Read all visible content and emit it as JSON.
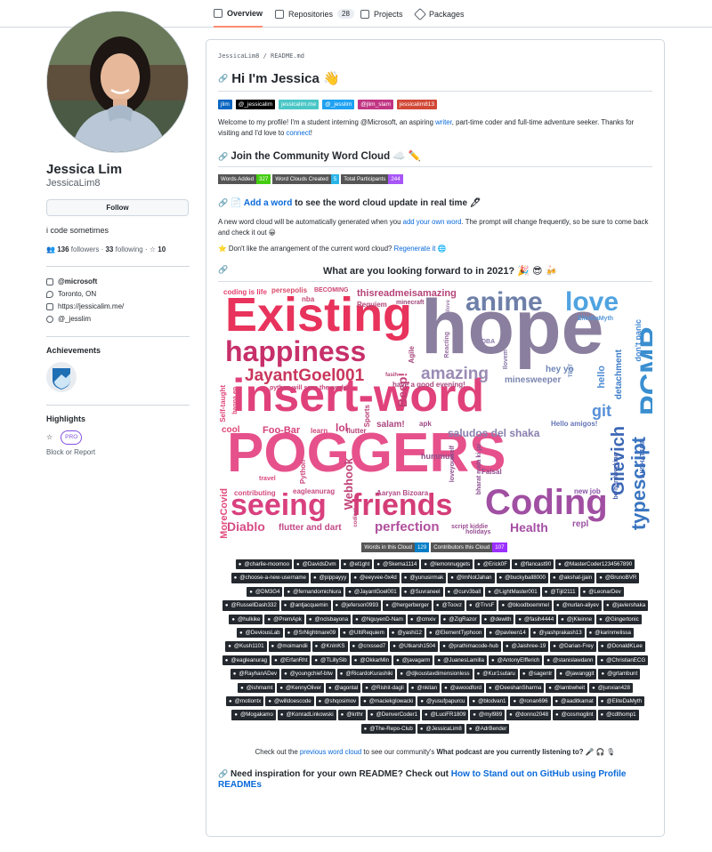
{
  "tabs": [
    {
      "label": "Overview"
    },
    {
      "label": "Repositories",
      "count": "28"
    },
    {
      "label": "Projects"
    },
    {
      "label": "Packages"
    }
  ],
  "profile": {
    "name": "Jessica Lim",
    "login": "JessicaLim8",
    "follow": "Follow",
    "bio": "i code sometimes",
    "followers_num": "136",
    "followers_label": "followers",
    "following_num": "33",
    "following_label": "following",
    "stars": "10",
    "org": "@microsoft",
    "location": "Toronto, ON",
    "website": "https://jessicalim.me/",
    "twitter": "@_jesslim"
  },
  "achievements": {
    "title": "Achievements"
  },
  "highlights": {
    "title": "Highlights",
    "pro": "PRO",
    "block": "Block or Report"
  },
  "readme": {
    "path": "JessicaLim8 / README.md",
    "title": "Hi I'm Jessica 👋",
    "socials": [
      {
        "label": "jlim",
        "color": "#0a66c2"
      },
      {
        "label": "@_jessicalim",
        "color": "#000000"
      },
      {
        "label": "jessicalim.me",
        "color": "#4ac6c6"
      },
      {
        "label": "@_jesslim",
        "color": "#1da1f2"
      },
      {
        "label": "@jlim_slam",
        "color": "#c13584"
      },
      {
        "label": "jessicalim813",
        "color": "#d14836"
      }
    ],
    "intro_a": "Welcome to my profile! I'm a student interning @Microsoft, an aspiring ",
    "intro_writer": "writer",
    "intro_b": ", part-time coder and full-time adventure seeker. Thanks for visiting and I'd love to ",
    "intro_connect": "connect",
    "intro_c": "!",
    "community_title": "Join the Community Word Cloud ☁️ ✏️",
    "stats": [
      {
        "l": "Words Added",
        "r": "327",
        "c": "#4c1"
      },
      {
        "l": "Word Clouds Created",
        "r": "5",
        "c": "#29b5e8"
      },
      {
        "l": "Total Participants",
        "r": "244",
        "c": "#a855f7"
      }
    ],
    "add_prefix": "📄 ",
    "add_link": "Add a word",
    "add_suffix": " to see the word cloud update in real time 🖊",
    "gen_a": "A new word cloud will be automatically generated when you ",
    "gen_link": "add your own word",
    "gen_b": ". The prompt will change frequently, so be sure to come back and check it out 😀",
    "regen_a": "⭐ Don't like the arrangement of the current word cloud? ",
    "regen_link": "Regenerate it",
    "regen_b": " 🌐",
    "cloud_title": "What are you looking forward to in 2021? 🎉 😎 🍻",
    "cloud_stats": [
      {
        "l": "Words in this Cloud",
        "r": "129",
        "c": "#007ec6"
      },
      {
        "l": "Contributors this Cloud",
        "r": "107",
        "c": "#9b30ff"
      }
    ],
    "contributors": [
      "@charlie-moomoo",
      "@DavidsDvm",
      "@el1ght",
      "@Skema1114",
      "@lemonnuggets",
      "@Erick0F",
      "@flancast90",
      "@MasterCoder1234567890",
      "@choose-a-new-username",
      "@pippayyy",
      "@eeyvee-0x4d",
      "@yunusirmak",
      "@ImNotJahan",
      "@buckyball8000",
      "@akshat-jjain",
      "@BrunoBVR",
      "@DM3G4",
      "@fernandomichiura",
      "@JayantGoel001",
      "@Suvraneel",
      "@curv3ball",
      "@LightMaster001",
      "@Tijil2111",
      "@LeonarDev",
      "@RussellDash332",
      "@antjacquemin",
      "@jeferson0993",
      "@hergerberger",
      "@Toovz",
      "@TrvsF",
      "@bloodboemmel",
      "@nurlan-aliyev",
      "@javiershaka",
      "@hulkike",
      "@PremApk",
      "@nclsbayona",
      "@NguyenD-Nam",
      "@cmxiv",
      "@ZigRazor",
      "@dewith",
      "@fasih4444",
      "@jKleinne",
      "@Gingertonic",
      "@DeviousLab",
      "@SrNightmare09",
      "@UltiRequiem",
      "@yashi12",
      "@ElementTyphoon",
      "@pavleen14",
      "@yashprakash13",
      "@karinmelissa",
      "@Kush1101",
      "@moimandii",
      "@KnInKS",
      "@crxssed7",
      "@Utkarsh1504",
      "@prathimacode-hub",
      "@Jaishree-19",
      "@Darian-Frey",
      "@DonaldKLee",
      "@eagleanurag",
      "@ErfanRht",
      "@TLillySib",
      "@OkkarMin",
      "@javagarm",
      "@JuanesLamilla",
      "@AntonyElfferich",
      "@stanislawdann",
      "@ChristianECG",
      "@RayhanADev",
      "@youngchief-btw",
      "@RicardoKurashiki",
      "@djkoustavdimensionless",
      "@Kur1sutaru",
      "@sagentr",
      "@jawanggit",
      "@grtambunt",
      "@ishmamt",
      "@KennyOliver",
      "@agontal",
      "@Rishit-dagli",
      "@nkitan",
      "@awoodford",
      "@DeeshanSharma",
      "@lambwheit",
      "@junxian428",
      "@motiontx",
      "@willdoescode",
      "@shqosimov",
      "@maciekglowacki",
      "@yusufpapurcu",
      "@blodvan1",
      "@ronan696",
      "@aaditkamat",
      "@EliteDaMyth",
      "@Mogakamo",
      "@KonradLinkowski",
      "@krthr",
      "@DenverCoder1",
      "@LuciFR1809",
      "@myl989",
      "@donno2048",
      "@cosmoglint",
      "@cdthomp1",
      "@The-Repo-Club",
      "@JessicaLim8",
      "@AdrBender"
    ],
    "foot_a": "Check out the ",
    "foot_link": "previous word cloud",
    "foot_b": " to see our community's ",
    "foot_bold": "What podcast are you currently listening to?",
    "foot_c": " 🎤 🎧 🎙",
    "need_a": "Need inspiration for your own README? Check out ",
    "need_link": "How to Stand out on GitHub using Profile READMEs"
  },
  "cloud_words": [
    "Existing",
    "hope",
    "insert-word",
    "POGGERS",
    "Coding",
    "seeing",
    "friends",
    "anime",
    "love",
    "happiness",
    "PCMR",
    "JayantGoel001",
    "amazing",
    "typescript",
    "Gilevich",
    "Diablo",
    "perfection",
    "Health",
    "saludos del shaka",
    "Webhook",
    "git",
    "minesweeper",
    "hey yo",
    "coding is life",
    "persepolis",
    "BECOMING",
    "thisreadmeisamazing",
    "Requiem",
    "minecraft",
    "nba",
    "Foo-Bar",
    "cool",
    "learn",
    "lol",
    "flutter",
    "salam!",
    "apk",
    "hummus",
    "Faisal",
    "flutter and dart",
    "NoMoreCovid",
    "travel",
    "contributing",
    "eagleanurag",
    "Aaryan Bizoara",
    "script kiddie",
    "holidays",
    "repl",
    "new job",
    "Hello amigos!",
    "detachment",
    "don't panic",
    "EliteDaMyth",
    "hello",
    "Beep!",
    "Agile",
    "Self-taught",
    "Python",
    "python will save the world!",
    "have a good evening!",
    "fasih",
    "Reacting",
    "Sports",
    "loveyourself",
    "be-hardworking",
    "AKSHATJAIN",
    "DBA",
    "bapna ep",
    "Ilove",
    "TEST",
    "Ilovem",
    "bharat mata ki jai",
    "coding!"
  ]
}
